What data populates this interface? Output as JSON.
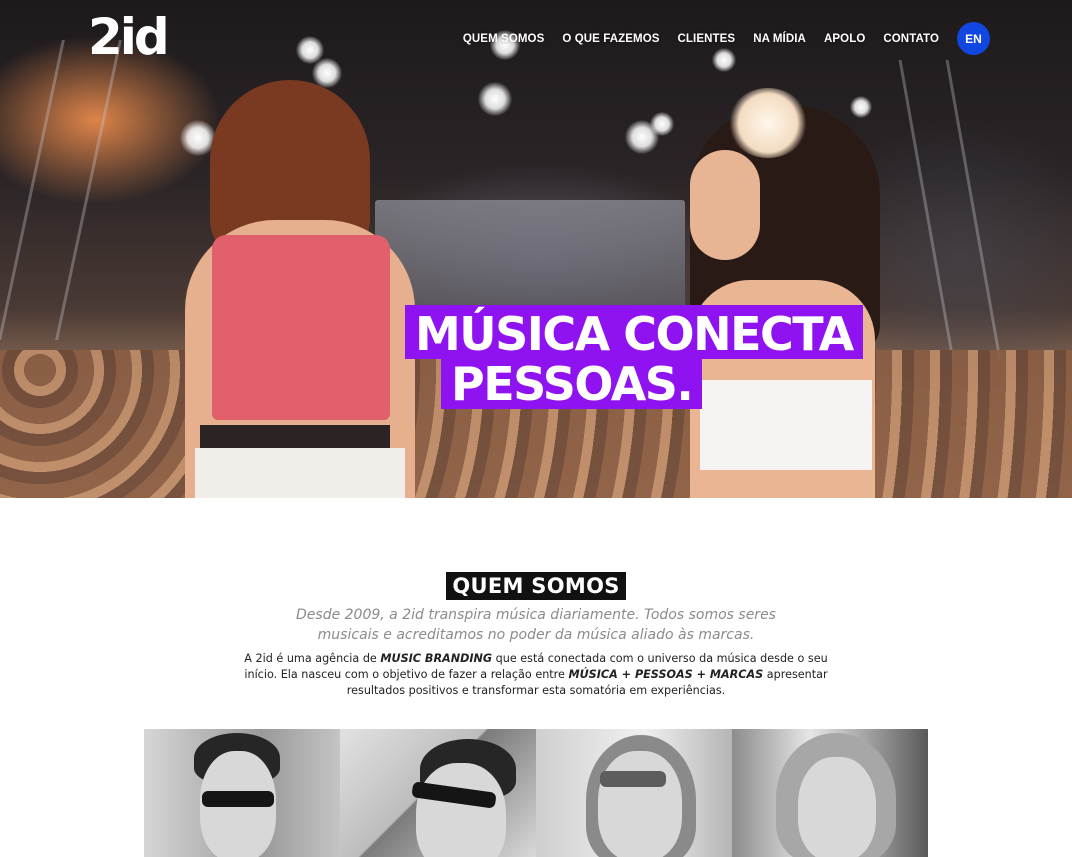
{
  "brand": {
    "logo_text": "2id"
  },
  "nav": {
    "items": [
      "QUEM SOMOS",
      "O QUE FAZEMOS",
      "CLIENTES",
      "NA MÍDIA",
      "APOLO",
      "CONTATO"
    ],
    "language_button": "EN"
  },
  "hero": {
    "headline_line1": "MÚSICA CONECTA",
    "headline_line2": "PESSOAS."
  },
  "about": {
    "title": "QUEM SOMOS",
    "lead": "Desde 2009, a 2id transpira música diariamente. Todos somos seres musicais e acreditamos no poder da música aliado às marcas.",
    "body_part1": "A 2id é uma agência de ",
    "body_em1": "MUSIC BRANDING",
    "body_part2": " que está conectada com o universo da música desde o seu início. Ela nasceu com o objetivo de fazer a relação entre ",
    "body_em2": "MÚSICA + PESSOAS + MARCAS",
    "body_part3": " apresentar resultados positivos e transformar esta somatória em experiências."
  },
  "colors": {
    "accent_purple": "#8f12f0",
    "language_blue": "#1246e0",
    "title_black": "#111111"
  },
  "icons": {
    "team_photos": "team-member-photo"
  }
}
